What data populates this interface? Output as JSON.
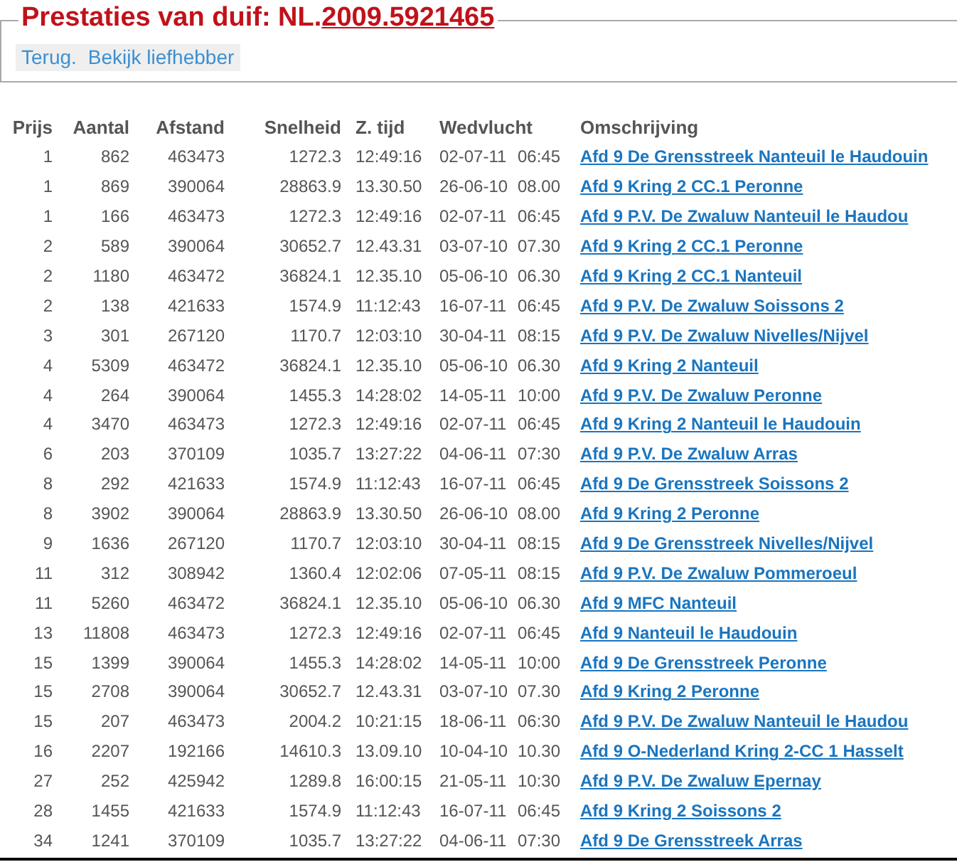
{
  "title": {
    "prefix": "Prestaties van duif: NL.",
    "ring": "2009.5921465"
  },
  "nav_links": [
    "Terug.",
    "Bekijk liefhebber"
  ],
  "table": {
    "columns": [
      "Prijs",
      "Aantal",
      "Afstand",
      "Snelheid",
      "Z. tijd",
      "Wedvlucht",
      "Omschrijving"
    ],
    "rows": [
      {
        "prijs": "1",
        "aantal": "862",
        "afstand": "463473",
        "snelheid": "1272.3",
        "z_tijd": "12:49:16",
        "date": "02-07-11",
        "time": "06:45",
        "omschrijving": "Afd 9 De Grensstreek Nanteuil le Haudouin"
      },
      {
        "prijs": "1",
        "aantal": "869",
        "afstand": "390064",
        "snelheid": "28863.9",
        "z_tijd": "13.30.50",
        "date": "26-06-10",
        "time": "08.00",
        "omschrijving": "Afd 9 Kring 2 CC.1 Peronne"
      },
      {
        "prijs": "1",
        "aantal": "166",
        "afstand": "463473",
        "snelheid": "1272.3",
        "z_tijd": "12:49:16",
        "date": "02-07-11",
        "time": "06:45",
        "omschrijving": "Afd 9 P.V. De Zwaluw Nanteuil le Haudou"
      },
      {
        "prijs": "2",
        "aantal": "589",
        "afstand": "390064",
        "snelheid": "30652.7",
        "z_tijd": "12.43.31",
        "date": "03-07-10",
        "time": "07.30",
        "omschrijving": "Afd 9 Kring 2 CC.1 Peronne"
      },
      {
        "prijs": "2",
        "aantal": "1180",
        "afstand": "463472",
        "snelheid": "36824.1",
        "z_tijd": "12.35.10",
        "date": "05-06-10",
        "time": "06.30",
        "omschrijving": "Afd 9 Kring 2 CC.1 Nanteuil"
      },
      {
        "prijs": "2",
        "aantal": "138",
        "afstand": "421633",
        "snelheid": "1574.9",
        "z_tijd": "11:12:43",
        "date": "16-07-11",
        "time": "06:45",
        "omschrijving": "Afd 9 P.V. De Zwaluw Soissons 2"
      },
      {
        "prijs": "3",
        "aantal": "301",
        "afstand": "267120",
        "snelheid": "1170.7",
        "z_tijd": "12:03:10",
        "date": "30-04-11",
        "time": "08:15",
        "omschrijving": "Afd 9 P.V. De Zwaluw Nivelles/Nijvel"
      },
      {
        "prijs": "4",
        "aantal": "5309",
        "afstand": "463472",
        "snelheid": "36824.1",
        "z_tijd": "12.35.10",
        "date": "05-06-10",
        "time": "06.30",
        "omschrijving": "Afd 9 Kring 2 Nanteuil"
      },
      {
        "prijs": "4",
        "aantal": "264",
        "afstand": "390064",
        "snelheid": "1455.3",
        "z_tijd": "14:28:02",
        "date": "14-05-11",
        "time": "10:00",
        "omschrijving": "Afd 9 P.V. De Zwaluw Peronne"
      },
      {
        "prijs": "4",
        "aantal": "3470",
        "afstand": "463473",
        "snelheid": "1272.3",
        "z_tijd": "12:49:16",
        "date": "02-07-11",
        "time": "06:45",
        "omschrijving": "Afd 9 Kring 2 Nanteuil le Haudouin"
      },
      {
        "prijs": "6",
        "aantal": "203",
        "afstand": "370109",
        "snelheid": "1035.7",
        "z_tijd": "13:27:22",
        "date": "04-06-11",
        "time": "07:30",
        "omschrijving": "Afd 9 P.V. De Zwaluw Arras"
      },
      {
        "prijs": "8",
        "aantal": "292",
        "afstand": "421633",
        "snelheid": "1574.9",
        "z_tijd": "11:12:43",
        "date": "16-07-11",
        "time": "06:45",
        "omschrijving": "Afd 9 De Grensstreek Soissons 2"
      },
      {
        "prijs": "8",
        "aantal": "3902",
        "afstand": "390064",
        "snelheid": "28863.9",
        "z_tijd": "13.30.50",
        "date": "26-06-10",
        "time": "08.00",
        "omschrijving": "Afd 9 Kring 2 Peronne"
      },
      {
        "prijs": "9",
        "aantal": "1636",
        "afstand": "267120",
        "snelheid": "1170.7",
        "z_tijd": "12:03:10",
        "date": "30-04-11",
        "time": "08:15",
        "omschrijving": "Afd 9 De Grensstreek Nivelles/Nijvel"
      },
      {
        "prijs": "11",
        "aantal": "312",
        "afstand": "308942",
        "snelheid": "1360.4",
        "z_tijd": "12:02:06",
        "date": "07-05-11",
        "time": "08:15",
        "omschrijving": "Afd 9 P.V. De Zwaluw Pommeroeul"
      },
      {
        "prijs": "11",
        "aantal": "5260",
        "afstand": "463472",
        "snelheid": "36824.1",
        "z_tijd": "12.35.10",
        "date": "05-06-10",
        "time": "06.30",
        "omschrijving": "Afd 9 MFC Nanteuil"
      },
      {
        "prijs": "13",
        "aantal": "11808",
        "afstand": "463473",
        "snelheid": "1272.3",
        "z_tijd": "12:49:16",
        "date": "02-07-11",
        "time": "06:45",
        "omschrijving": "Afd 9 Nanteuil le Haudouin"
      },
      {
        "prijs": "15",
        "aantal": "1399",
        "afstand": "390064",
        "snelheid": "1455.3",
        "z_tijd": "14:28:02",
        "date": "14-05-11",
        "time": "10:00",
        "omschrijving": "Afd 9 De Grensstreek Peronne"
      },
      {
        "prijs": "15",
        "aantal": "2708",
        "afstand": "390064",
        "snelheid": "30652.7",
        "z_tijd": "12.43.31",
        "date": "03-07-10",
        "time": "07.30",
        "omschrijving": "Afd 9 Kring 2 Peronne"
      },
      {
        "prijs": "15",
        "aantal": "207",
        "afstand": "463473",
        "snelheid": "2004.2",
        "z_tijd": "10:21:15",
        "date": "18-06-11",
        "time": "06:30",
        "omschrijving": "Afd 9 P.V. De Zwaluw Nanteuil le Haudou"
      },
      {
        "prijs": "16",
        "aantal": "2207",
        "afstand": "192166",
        "snelheid": "14610.3",
        "z_tijd": "13.09.10",
        "date": "10-04-10",
        "time": "10.30",
        "omschrijving": "Afd 9 O-Nederland Kring 2-CC 1 Hasselt"
      },
      {
        "prijs": "27",
        "aantal": "252",
        "afstand": "425942",
        "snelheid": "1289.8",
        "z_tijd": "16:00:15",
        "date": "21-05-11",
        "time": "10:30",
        "omschrijving": "Afd 9 P.V. De Zwaluw Epernay"
      },
      {
        "prijs": "28",
        "aantal": "1455",
        "afstand": "421633",
        "snelheid": "1574.9",
        "z_tijd": "11:12:43",
        "date": "16-07-11",
        "time": "06:45",
        "omschrijving": "Afd 9 Kring 2 Soissons 2"
      },
      {
        "prijs": "34",
        "aantal": "1241",
        "afstand": "370109",
        "snelheid": "1035.7",
        "z_tijd": "13:27:22",
        "date": "04-06-11",
        "time": "07:30",
        "omschrijving": "Afd 9 De Grensstreek Arras"
      }
    ]
  }
}
